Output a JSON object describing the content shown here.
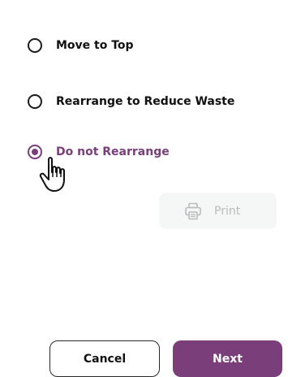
{
  "options": [
    {
      "label": "Move to Top",
      "selected": false
    },
    {
      "label": "Rearrange to Reduce Waste",
      "selected": false
    },
    {
      "label": "Do not Rearrange",
      "selected": true
    }
  ],
  "print_button": {
    "label": "Print",
    "icon": "printer-icon",
    "disabled": true
  },
  "footer": {
    "cancel_label": "Cancel",
    "next_label": "Next"
  },
  "colors": {
    "accent": "#7a3e7a",
    "text": "#111111",
    "disabled_bg": "#f5f6f6",
    "disabled_text": "#b9bcbe"
  }
}
